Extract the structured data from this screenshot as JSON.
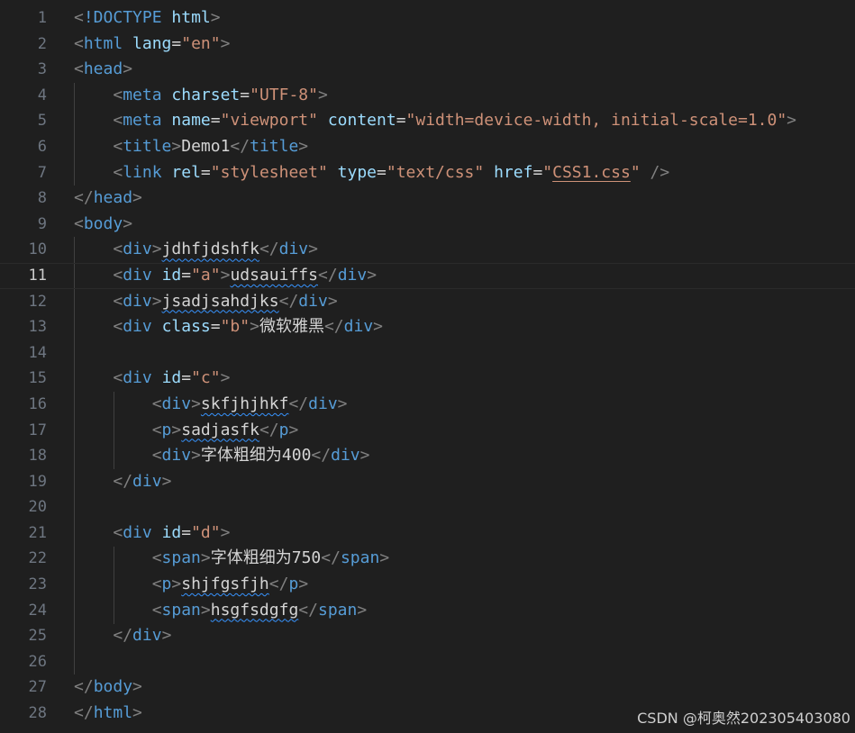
{
  "editor": {
    "active_line": 11,
    "colors": {
      "background": "#1f1f1f",
      "tag": "#569cd6",
      "attribute": "#9cdcfe",
      "string": "#ce9178",
      "punctuation": "#808080",
      "text": "#d4d4d4",
      "line_number": "#6e7681",
      "spell_underline": "#3794ff"
    },
    "line_numbers": [
      "1",
      "2",
      "3",
      "4",
      "5",
      "6",
      "7",
      "8",
      "9",
      "10",
      "11",
      "12",
      "13",
      "14",
      "15",
      "16",
      "17",
      "18",
      "19",
      "20",
      "21",
      "22",
      "23",
      "24",
      "25",
      "26",
      "27",
      "28"
    ],
    "lines": [
      [
        {
          "k": "br",
          "t": "<"
        },
        {
          "k": "tag",
          "t": "!DOCTYPE"
        },
        {
          "k": "txt",
          "t": " "
        },
        {
          "k": "attr",
          "t": "html"
        },
        {
          "k": "br",
          "t": ">"
        }
      ],
      [
        {
          "k": "br",
          "t": "<"
        },
        {
          "k": "tag",
          "t": "html"
        },
        {
          "k": "txt",
          "t": " "
        },
        {
          "k": "attr",
          "t": "lang"
        },
        {
          "k": "txt",
          "t": "="
        },
        {
          "k": "str",
          "t": "\"en\""
        },
        {
          "k": "br",
          "t": ">"
        }
      ],
      [
        {
          "k": "br",
          "t": "<"
        },
        {
          "k": "tag",
          "t": "head"
        },
        {
          "k": "br",
          "t": ">"
        }
      ],
      [
        {
          "k": "txt",
          "t": "    "
        },
        {
          "k": "br",
          "t": "<"
        },
        {
          "k": "tag",
          "t": "meta"
        },
        {
          "k": "txt",
          "t": " "
        },
        {
          "k": "attr",
          "t": "charset"
        },
        {
          "k": "txt",
          "t": "="
        },
        {
          "k": "str",
          "t": "\"UTF-8\""
        },
        {
          "k": "br",
          "t": ">"
        }
      ],
      [
        {
          "k": "txt",
          "t": "    "
        },
        {
          "k": "br",
          "t": "<"
        },
        {
          "k": "tag",
          "t": "meta"
        },
        {
          "k": "txt",
          "t": " "
        },
        {
          "k": "attr",
          "t": "name"
        },
        {
          "k": "txt",
          "t": "="
        },
        {
          "k": "str",
          "t": "\"viewport\""
        },
        {
          "k": "txt",
          "t": " "
        },
        {
          "k": "attr",
          "t": "content"
        },
        {
          "k": "txt",
          "t": "="
        },
        {
          "k": "str",
          "t": "\"width=device-width, initial-scale=1.0\""
        },
        {
          "k": "br",
          "t": ">"
        }
      ],
      [
        {
          "k": "txt",
          "t": "    "
        },
        {
          "k": "br",
          "t": "<"
        },
        {
          "k": "tag",
          "t": "title"
        },
        {
          "k": "br",
          "t": ">"
        },
        {
          "k": "txt",
          "t": "Demo1"
        },
        {
          "k": "br",
          "t": "</"
        },
        {
          "k": "tag",
          "t": "title"
        },
        {
          "k": "br",
          "t": ">"
        }
      ],
      [
        {
          "k": "txt",
          "t": "    "
        },
        {
          "k": "br",
          "t": "<"
        },
        {
          "k": "tag",
          "t": "link"
        },
        {
          "k": "txt",
          "t": " "
        },
        {
          "k": "attr",
          "t": "rel"
        },
        {
          "k": "txt",
          "t": "="
        },
        {
          "k": "str",
          "t": "\"stylesheet\""
        },
        {
          "k": "txt",
          "t": " "
        },
        {
          "k": "attr",
          "t": "type"
        },
        {
          "k": "txt",
          "t": "="
        },
        {
          "k": "str",
          "t": "\"text/css\""
        },
        {
          "k": "txt",
          "t": " "
        },
        {
          "k": "attr",
          "t": "href"
        },
        {
          "k": "txt",
          "t": "="
        },
        {
          "k": "str",
          "t": "\""
        },
        {
          "k": "str link-under",
          "t": "CSS1.css"
        },
        {
          "k": "str",
          "t": "\""
        },
        {
          "k": "txt",
          "t": " "
        },
        {
          "k": "br",
          "t": "/>"
        }
      ],
      [
        {
          "k": "br",
          "t": "</"
        },
        {
          "k": "tag",
          "t": "head"
        },
        {
          "k": "br",
          "t": ">"
        }
      ],
      [
        {
          "k": "br",
          "t": "<"
        },
        {
          "k": "tag",
          "t": "body"
        },
        {
          "k": "br",
          "t": ">"
        }
      ],
      [
        {
          "k": "txt",
          "t": "    "
        },
        {
          "k": "br",
          "t": "<"
        },
        {
          "k": "tag",
          "t": "div"
        },
        {
          "k": "br",
          "t": ">"
        },
        {
          "k": "txt squig",
          "t": "jdhfjdshfk"
        },
        {
          "k": "br",
          "t": "</"
        },
        {
          "k": "tag",
          "t": "div"
        },
        {
          "k": "br",
          "t": ">"
        }
      ],
      [
        {
          "k": "txt",
          "t": "    "
        },
        {
          "k": "br",
          "t": "<"
        },
        {
          "k": "tag",
          "t": "div"
        },
        {
          "k": "txt",
          "t": " "
        },
        {
          "k": "attr",
          "t": "id"
        },
        {
          "k": "txt",
          "t": "="
        },
        {
          "k": "str",
          "t": "\"a\""
        },
        {
          "k": "br",
          "t": ">"
        },
        {
          "k": "txt squig",
          "t": "udsauiffs"
        },
        {
          "k": "br",
          "t": "</"
        },
        {
          "k": "tag",
          "t": "div"
        },
        {
          "k": "br",
          "t": ">"
        }
      ],
      [
        {
          "k": "txt",
          "t": "    "
        },
        {
          "k": "br",
          "t": "<"
        },
        {
          "k": "tag",
          "t": "div"
        },
        {
          "k": "br",
          "t": ">"
        },
        {
          "k": "txt squig",
          "t": "jsadjsahdjks"
        },
        {
          "k": "br",
          "t": "</"
        },
        {
          "k": "tag",
          "t": "div"
        },
        {
          "k": "br",
          "t": ">"
        }
      ],
      [
        {
          "k": "txt",
          "t": "    "
        },
        {
          "k": "br",
          "t": "<"
        },
        {
          "k": "tag",
          "t": "div"
        },
        {
          "k": "txt",
          "t": " "
        },
        {
          "k": "attr",
          "t": "class"
        },
        {
          "k": "txt",
          "t": "="
        },
        {
          "k": "str",
          "t": "\"b\""
        },
        {
          "k": "br",
          "t": ">"
        },
        {
          "k": "txt",
          "t": "微软雅黑"
        },
        {
          "k": "br",
          "t": "</"
        },
        {
          "k": "tag",
          "t": "div"
        },
        {
          "k": "br",
          "t": ">"
        }
      ],
      [],
      [
        {
          "k": "txt",
          "t": "    "
        },
        {
          "k": "br",
          "t": "<"
        },
        {
          "k": "tag",
          "t": "div"
        },
        {
          "k": "txt",
          "t": " "
        },
        {
          "k": "attr",
          "t": "id"
        },
        {
          "k": "txt",
          "t": "="
        },
        {
          "k": "str",
          "t": "\"c\""
        },
        {
          "k": "br",
          "t": ">"
        }
      ],
      [
        {
          "k": "txt",
          "t": "        "
        },
        {
          "k": "br",
          "t": "<"
        },
        {
          "k": "tag",
          "t": "div"
        },
        {
          "k": "br",
          "t": ">"
        },
        {
          "k": "txt squig",
          "t": "skfjhjhkf"
        },
        {
          "k": "br",
          "t": "</"
        },
        {
          "k": "tag",
          "t": "div"
        },
        {
          "k": "br",
          "t": ">"
        }
      ],
      [
        {
          "k": "txt",
          "t": "        "
        },
        {
          "k": "br",
          "t": "<"
        },
        {
          "k": "tag",
          "t": "p"
        },
        {
          "k": "br",
          "t": ">"
        },
        {
          "k": "txt squig",
          "t": "sadjasfk"
        },
        {
          "k": "br",
          "t": "</"
        },
        {
          "k": "tag",
          "t": "p"
        },
        {
          "k": "br",
          "t": ">"
        }
      ],
      [
        {
          "k": "txt",
          "t": "        "
        },
        {
          "k": "br",
          "t": "<"
        },
        {
          "k": "tag",
          "t": "div"
        },
        {
          "k": "br",
          "t": ">"
        },
        {
          "k": "txt",
          "t": "字体粗细为400"
        },
        {
          "k": "br",
          "t": "</"
        },
        {
          "k": "tag",
          "t": "div"
        },
        {
          "k": "br",
          "t": ">"
        }
      ],
      [
        {
          "k": "txt",
          "t": "    "
        },
        {
          "k": "br",
          "t": "</"
        },
        {
          "k": "tag",
          "t": "div"
        },
        {
          "k": "br",
          "t": ">"
        }
      ],
      [],
      [
        {
          "k": "txt",
          "t": "    "
        },
        {
          "k": "br",
          "t": "<"
        },
        {
          "k": "tag",
          "t": "div"
        },
        {
          "k": "txt",
          "t": " "
        },
        {
          "k": "attr",
          "t": "id"
        },
        {
          "k": "txt",
          "t": "="
        },
        {
          "k": "str",
          "t": "\"d\""
        },
        {
          "k": "br",
          "t": ">"
        }
      ],
      [
        {
          "k": "txt",
          "t": "        "
        },
        {
          "k": "br",
          "t": "<"
        },
        {
          "k": "tag",
          "t": "span"
        },
        {
          "k": "br",
          "t": ">"
        },
        {
          "k": "txt",
          "t": "字体粗细为750"
        },
        {
          "k": "br",
          "t": "</"
        },
        {
          "k": "tag",
          "t": "span"
        },
        {
          "k": "br",
          "t": ">"
        }
      ],
      [
        {
          "k": "txt",
          "t": "        "
        },
        {
          "k": "br",
          "t": "<"
        },
        {
          "k": "tag",
          "t": "p"
        },
        {
          "k": "br",
          "t": ">"
        },
        {
          "k": "txt squig",
          "t": "shjfgsfjh"
        },
        {
          "k": "br",
          "t": "</"
        },
        {
          "k": "tag",
          "t": "p"
        },
        {
          "k": "br",
          "t": ">"
        }
      ],
      [
        {
          "k": "txt",
          "t": "        "
        },
        {
          "k": "br",
          "t": "<"
        },
        {
          "k": "tag",
          "t": "span"
        },
        {
          "k": "br",
          "t": ">"
        },
        {
          "k": "txt squig",
          "t": "hsgfsdgfg"
        },
        {
          "k": "br",
          "t": "</"
        },
        {
          "k": "tag",
          "t": "span"
        },
        {
          "k": "br",
          "t": ">"
        }
      ],
      [
        {
          "k": "txt",
          "t": "    "
        },
        {
          "k": "br",
          "t": "</"
        },
        {
          "k": "tag",
          "t": "div"
        },
        {
          "k": "br",
          "t": ">"
        }
      ],
      [],
      [
        {
          "k": "br",
          "t": "</"
        },
        {
          "k": "tag",
          "t": "body"
        },
        {
          "k": "br",
          "t": ">"
        }
      ],
      [
        {
          "k": "br",
          "t": "</"
        },
        {
          "k": "tag",
          "t": "html"
        },
        {
          "k": "br",
          "t": ">"
        }
      ]
    ]
  },
  "watermark": "CSDN @柯奥然202305403080"
}
